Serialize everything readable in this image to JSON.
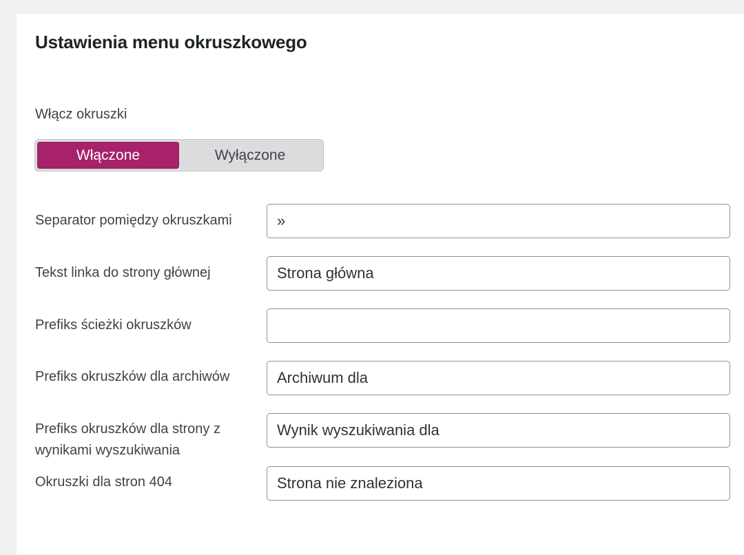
{
  "section": {
    "title": "Ustawienia menu okruszkowego"
  },
  "enable": {
    "label": "Włącz okruszki",
    "on_label": "Włączone",
    "off_label": "Wyłączone",
    "selected": "on"
  },
  "fields": [
    {
      "label": "Separator pomiędzy okruszkami",
      "value": "»",
      "placeholder": ""
    },
    {
      "label": "Tekst linka do strony głównej",
      "value": "Strona główna",
      "placeholder": ""
    },
    {
      "label": "Prefiks ścieżki okruszków",
      "value": "",
      "placeholder": ""
    },
    {
      "label": "Prefiks okruszków dla archiwów",
      "value": "Archiwum dla",
      "placeholder": ""
    },
    {
      "label": "Prefiks okruszków dla strony z wynikami wyszukiwania",
      "value": "Wynik wyszukiwania dla",
      "placeholder": ""
    },
    {
      "label": "Okruszki dla stron 404",
      "value": "Strona nie znaleziona",
      "placeholder": ""
    }
  ],
  "colors": {
    "accent": "#a7226a",
    "page_background": "#f0f0f1",
    "panel_background": "#ffffff",
    "input_border": "#8c8f94"
  }
}
